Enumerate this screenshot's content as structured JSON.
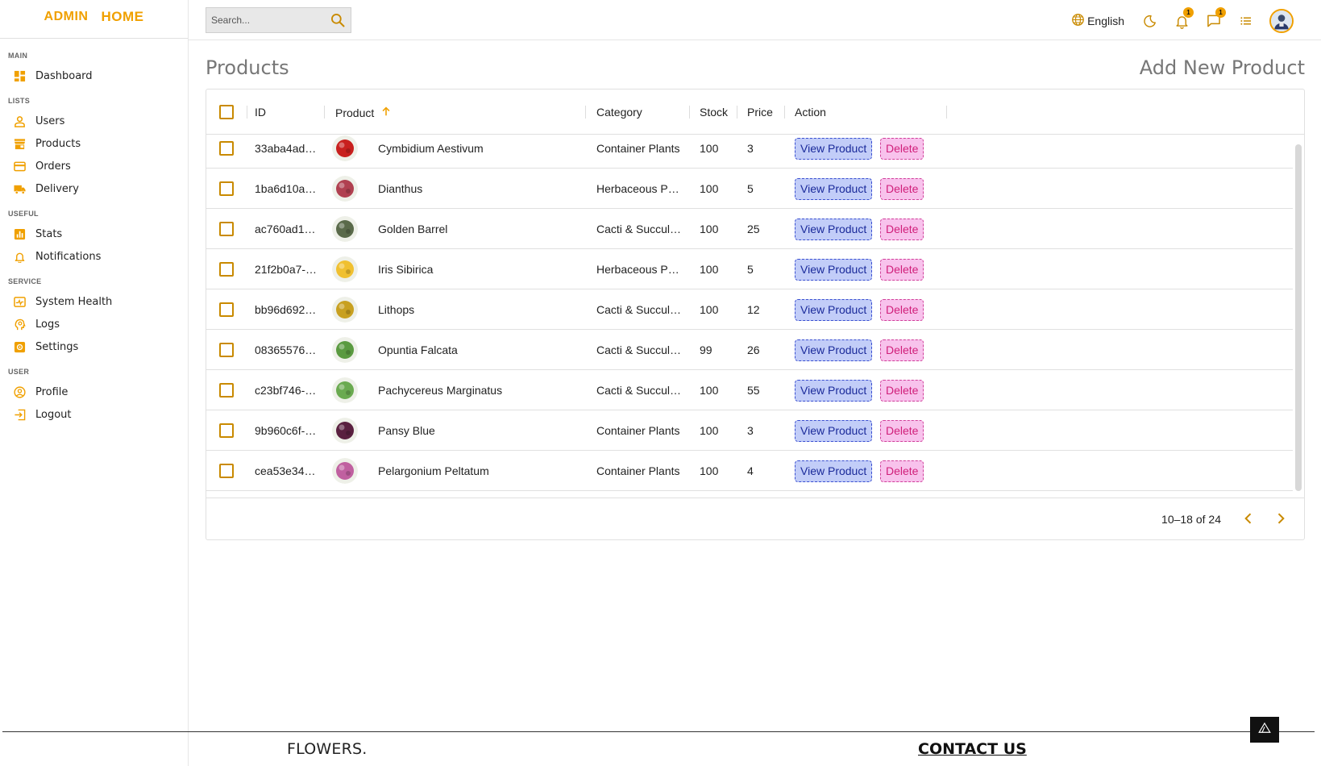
{
  "brand": {
    "part1": "ADMIN",
    "part2": "HOME"
  },
  "search": {
    "placeholder": "Search..."
  },
  "topbar": {
    "language": "English",
    "notifications_count": "1",
    "messages_count": "1"
  },
  "sidebar": {
    "sections": [
      {
        "title": "MAIN",
        "items": [
          {
            "label": "Dashboard",
            "icon": "dashboard-icon"
          }
        ]
      },
      {
        "title": "LISTS",
        "items": [
          {
            "label": "Users",
            "icon": "user-icon"
          },
          {
            "label": "Products",
            "icon": "store-icon"
          },
          {
            "label": "Orders",
            "icon": "credit-card-icon"
          },
          {
            "label": "Delivery",
            "icon": "truck-icon"
          }
        ]
      },
      {
        "title": "USEFUL",
        "items": [
          {
            "label": "Stats",
            "icon": "chart-icon"
          },
          {
            "label": "Notifications",
            "icon": "bell-icon"
          }
        ]
      },
      {
        "title": "SERVICE",
        "items": [
          {
            "label": "System Health",
            "icon": "health-icon"
          },
          {
            "label": "Logs",
            "icon": "psychology-icon"
          },
          {
            "label": "Settings",
            "icon": "settings-icon"
          }
        ]
      },
      {
        "title": "USER",
        "items": [
          {
            "label": "Profile",
            "icon": "account-circle-icon"
          },
          {
            "label": "Logout",
            "icon": "logout-icon"
          }
        ]
      }
    ]
  },
  "main": {
    "title": "Products",
    "add_new": "Add New Product"
  },
  "table": {
    "columns": {
      "id": "ID",
      "product": "Product",
      "category": "Category",
      "stock": "Stock",
      "price": "Price",
      "action": "Action"
    },
    "view_label": "View Product",
    "delete_label": "Delete",
    "rows": [
      {
        "id": "33aba4ad…",
        "name": "Cymbidium Aestivum",
        "category": "Container Plants",
        "stock": "100",
        "price": "3",
        "thumb_color": "#c8201e"
      },
      {
        "id": "1ba6d10a…",
        "name": "Dianthus",
        "category": "Herbaceous P…",
        "stock": "100",
        "price": "5",
        "thumb_color": "#b04050"
      },
      {
        "id": "ac760ad1…",
        "name": "Golden Barrel",
        "category": "Cacti & Succul…",
        "stock": "100",
        "price": "25",
        "thumb_color": "#5a6a4a"
      },
      {
        "id": "21f2b0a7-…",
        "name": "Iris Sibirica",
        "category": "Herbaceous P…",
        "stock": "100",
        "price": "5",
        "thumb_color": "#f0c030"
      },
      {
        "id": "bb96d692…",
        "name": "Lithops",
        "category": "Cacti & Succul…",
        "stock": "100",
        "price": "12",
        "thumb_color": "#c8a020"
      },
      {
        "id": "08365576…",
        "name": "Opuntia Falcata",
        "category": "Cacti & Succul…",
        "stock": "99",
        "price": "26",
        "thumb_color": "#5a9a40"
      },
      {
        "id": "c23bf746-…",
        "name": "Pachycereus Marginatus",
        "category": "Cacti & Succul…",
        "stock": "100",
        "price": "55",
        "thumb_color": "#6aaa50"
      },
      {
        "id": "9b960c6f-…",
        "name": "Pansy Blue",
        "category": "Container Plants",
        "stock": "100",
        "price": "3",
        "thumb_color": "#5a2040"
      },
      {
        "id": "cea53e34…",
        "name": "Pelargonium Peltatum",
        "category": "Container Plants",
        "stock": "100",
        "price": "4",
        "thumb_color": "#c060a0"
      }
    ],
    "pagination": "10–18 of 24"
  },
  "footer": {
    "logo": "FLOWERS.",
    "contact": "CONTACT US"
  },
  "colors": {
    "accent": "#f0a000",
    "view_bg": "#c2cdf8",
    "delete_bg": "#f8c2ec"
  }
}
